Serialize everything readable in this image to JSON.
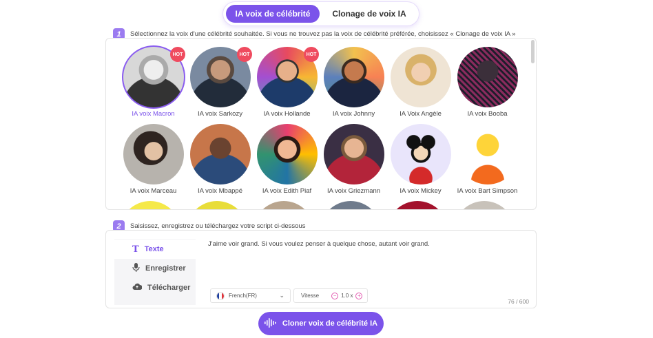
{
  "tabs": [
    {
      "label": "IA voix de célébrité",
      "active": true
    },
    {
      "label": "Clonage de voix IA",
      "active": false
    }
  ],
  "step1": {
    "number": "1",
    "text": "Sélectionnez la voix d'une célébrité souhaitée. Si vous ne trouvez pas la voix de célébrité préférée, choisissez « Clonage de voix IA »"
  },
  "step2": {
    "number": "2",
    "text": "Saisissez, enregistrez ou téléchargez votre script ci-dessous"
  },
  "hot_label": "HOT",
  "voices": [
    {
      "name": "IA voix Macron",
      "hot": true,
      "selected": true
    },
    {
      "name": "IA voix Sarkozy",
      "hot": true,
      "selected": false
    },
    {
      "name": "IA voix Hollande",
      "hot": true,
      "selected": false
    },
    {
      "name": "IA voix Johnny",
      "hot": false,
      "selected": false
    },
    {
      "name": "IA Voix Angèle",
      "hot": false,
      "selected": false
    },
    {
      "name": "IA voix Booba",
      "hot": false,
      "selected": false
    },
    {
      "name": "IA voix Marceau",
      "hot": false,
      "selected": false
    },
    {
      "name": "IA voix Mbappé",
      "hot": false,
      "selected": false
    },
    {
      "name": "IA voix Edith Piaf",
      "hot": false,
      "selected": false
    },
    {
      "name": "IA voix Griezmann",
      "hot": false,
      "selected": false
    },
    {
      "name": "IA voix Mickey",
      "hot": false,
      "selected": false
    },
    {
      "name": "IA voix Bart Simpson",
      "hot": false,
      "selected": false
    }
  ],
  "input_modes": {
    "text": "Texte",
    "record": "Enregistrer",
    "upload": "Télécharger"
  },
  "script": "J'aime voir grand. Si vous voulez penser à quelque chose, autant voir grand.",
  "language": "French(FR)",
  "speed": {
    "label": "Vitesse",
    "value": "1.0 x"
  },
  "counter": "76 / 600",
  "cta_label": "Cloner voix de célébrité IA",
  "colors": {
    "accent": "#7b53ea",
    "hot": "#ef4b5f"
  }
}
